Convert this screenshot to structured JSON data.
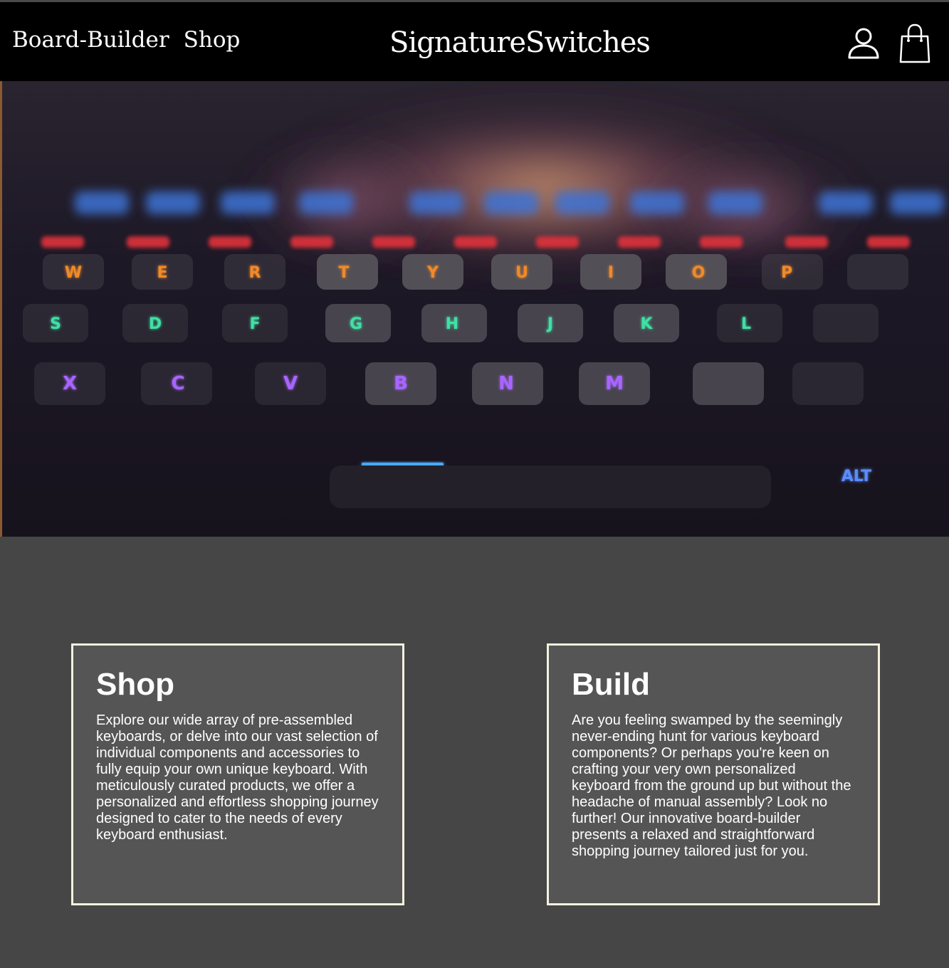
{
  "header": {
    "nav": [
      {
        "label": "Board-Builder"
      },
      {
        "label": "Shop"
      }
    ],
    "brand": "SignatureSwitches",
    "icons": [
      "user-icon",
      "shopping-bag-icon"
    ]
  },
  "hero": {
    "image": "backlit mechanical keyboard photo",
    "key_letters": {
      "row1": [
        "W",
        "E",
        "R",
        "T",
        "Y",
        "U",
        "I",
        "O",
        "P"
      ],
      "row2": [
        "S",
        "D",
        "F",
        "G",
        "H",
        "J",
        "K",
        "L"
      ],
      "row3": [
        "X",
        "C",
        "V",
        "B",
        "N",
        "M"
      ],
      "alt": "ALT"
    }
  },
  "cards": [
    {
      "title": "Shop",
      "body": "Explore our wide array of pre-assembled keyboards, or delve into our vast selection of individual components and accessories to fully equip your own unique keyboard. With meticulously curated products, we offer a personalized and effortless shopping journey designed to cater to the needs of every keyboard enthusiast."
    },
    {
      "title": "Build",
      "body": "Are you feeling swamped by the seemingly never-ending hunt for various keyboard components? Or perhaps you're keen on crafting your very own personalized keyboard from the ground up but without the headache of manual assembly? Look no further! Our innovative board-builder presents a relaxed and straightforward shopping journey tailored just for you."
    }
  ],
  "colors": {
    "header_bg": "#000000",
    "page_bg": "#464646",
    "card_bg": "#555555",
    "card_border": "#f4f2e0"
  }
}
